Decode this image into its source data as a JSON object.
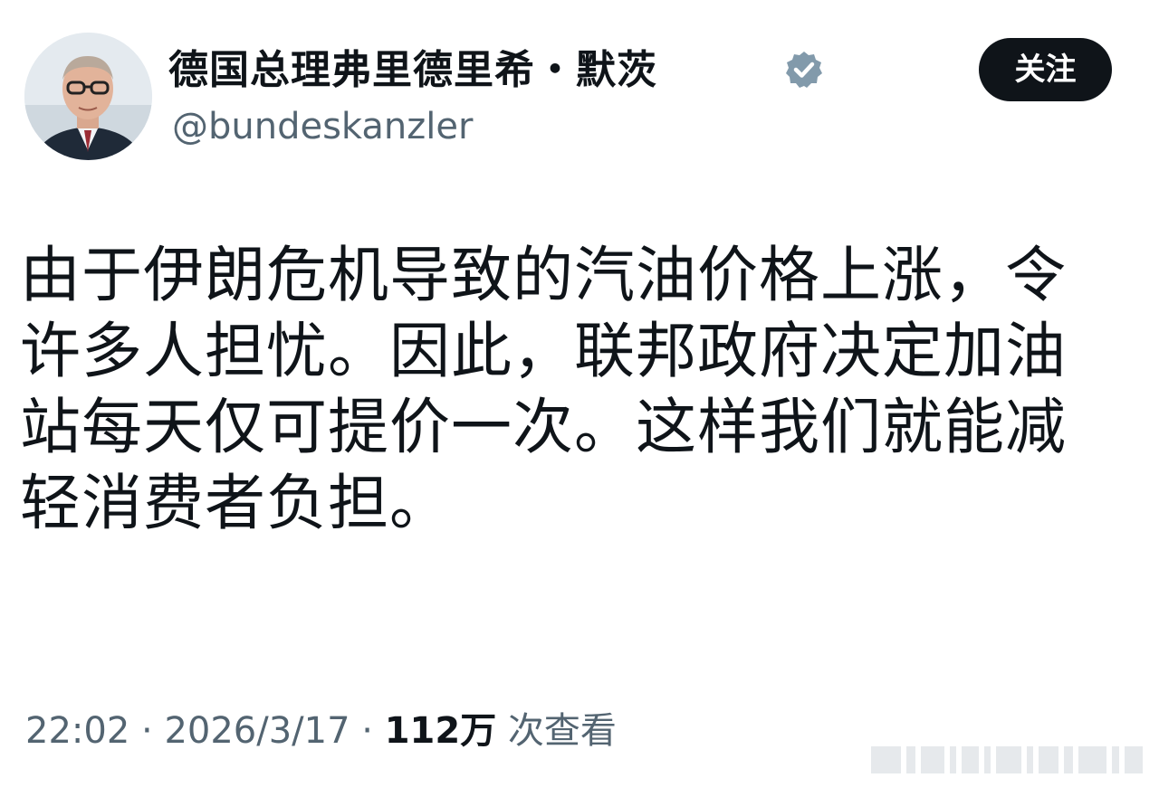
{
  "profile": {
    "display_name": "德国总理弗里德里希・默茨",
    "handle": "@bundeskanzler",
    "verified_icon": "verified-badge-icon",
    "verified_color": "#829aab"
  },
  "actions": {
    "follow_label": "关注"
  },
  "tweet": {
    "text": "由于伊朗危机导致的汽油价格上涨，令许多人担忧。因此，联邦政府决定加油站每天仅可提价一次。这样我们就能减轻消费者负担。"
  },
  "meta": {
    "time": "22:02",
    "separator": " · ",
    "date": "2026/3/17",
    "views_count": "112万",
    "views_label": " 次查看"
  },
  "colors": {
    "text_primary": "#0f1419",
    "text_secondary": "#536471",
    "button_bg": "#0f1419"
  }
}
